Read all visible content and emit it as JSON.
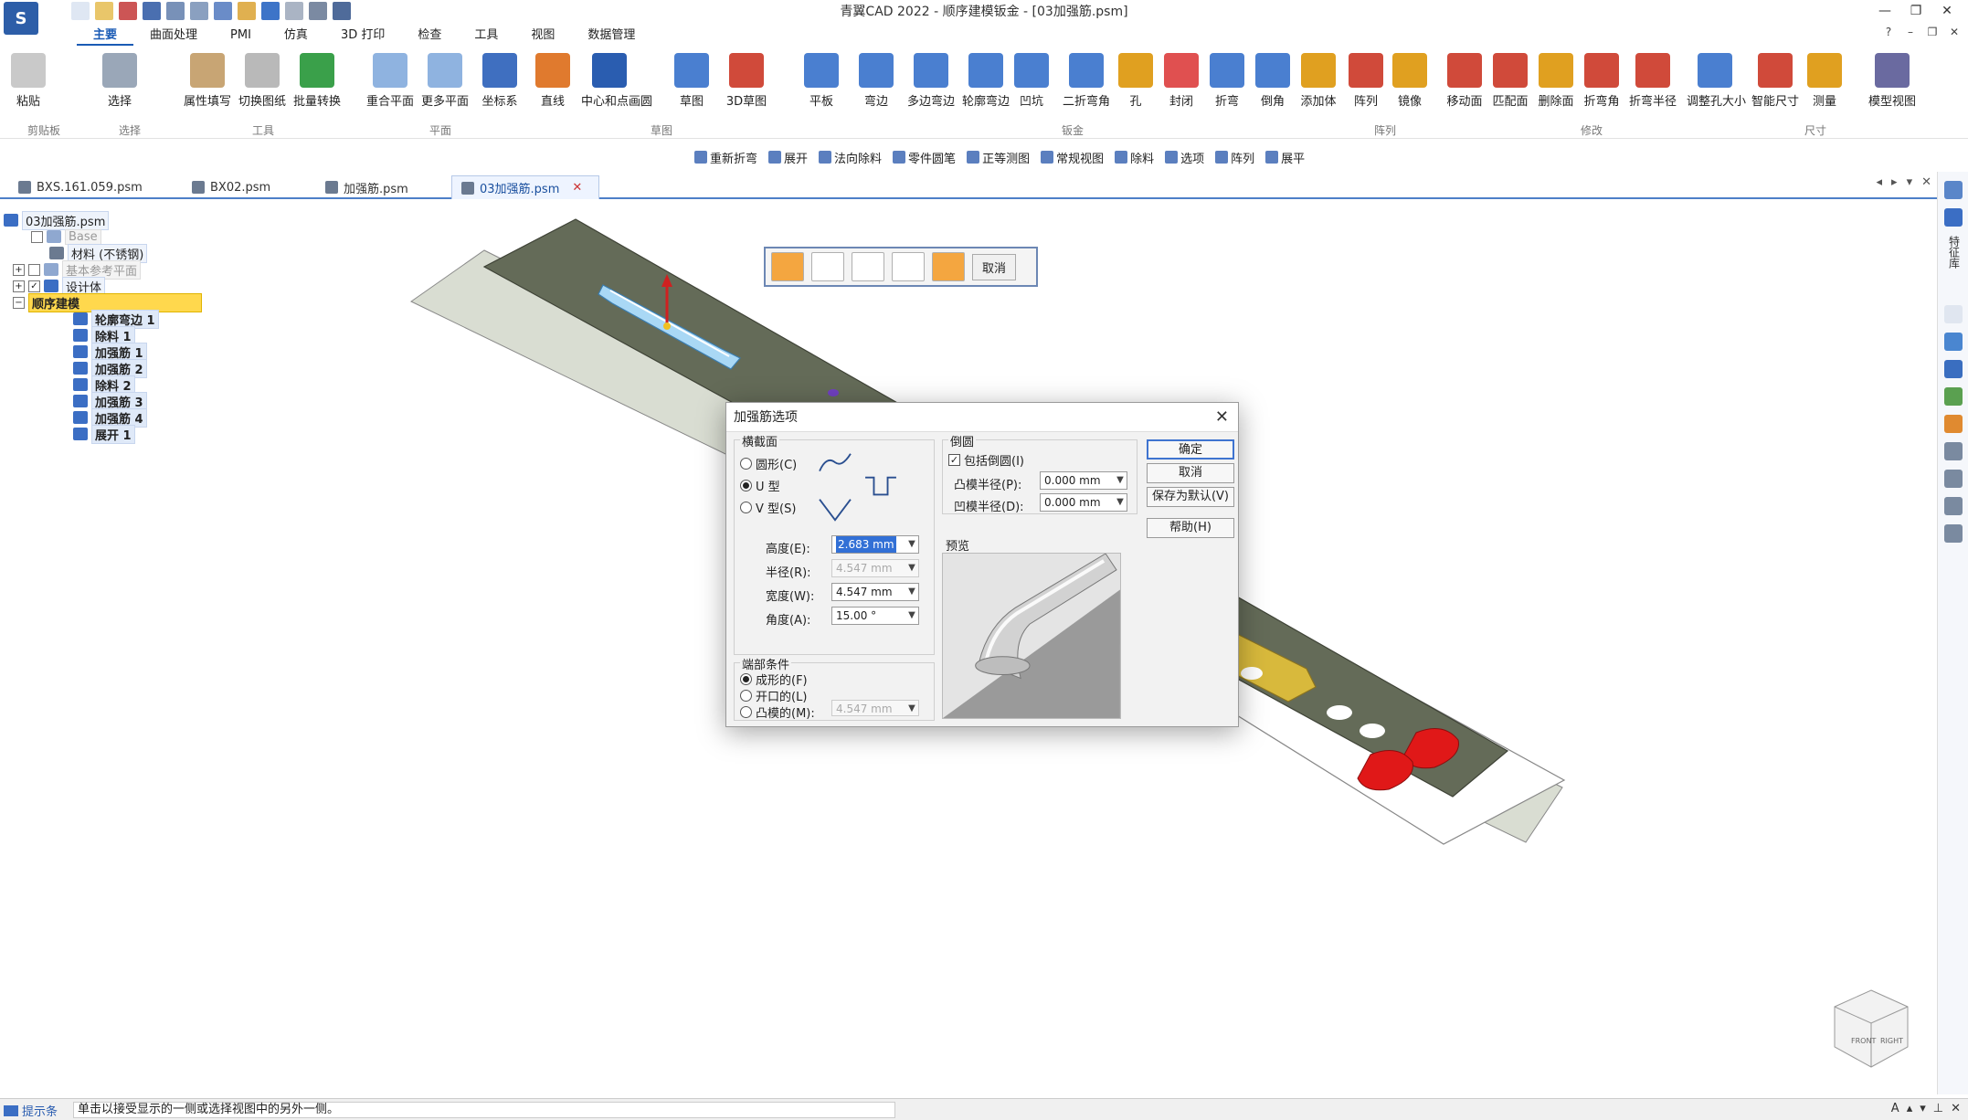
{
  "app": {
    "logo": "S",
    "title": "青翼CAD 2022 - 顺序建模钣金 - [03加强筋.psm]"
  },
  "window_controls": [
    "—",
    "❐",
    "✕"
  ],
  "ribbon_tabs": [
    "主要",
    "曲面处理",
    "PMI",
    "仿真",
    "3D 打印",
    "检查",
    "工具",
    "视图",
    "数据管理"
  ],
  "ribbon_buttons": [
    {
      "label": "粘贴",
      "color": "#c9c9c9"
    },
    {
      "label": "选择",
      "color": "#9aa7b8"
    },
    {
      "label": "属性填写",
      "color": "#c8a574"
    },
    {
      "label": "切换图纸",
      "color": "#b9b9b9"
    },
    {
      "label": "批量转换",
      "color": "#3aa04a"
    },
    {
      "label": "重合平面",
      "color": "#8fb3e0"
    },
    {
      "label": "更多平面",
      "color": "#8fb3e0"
    },
    {
      "label": "坐标系",
      "color": "#3f6fc0"
    },
    {
      "label": "直线",
      "color": "#e07a2e"
    },
    {
      "label": "中心和点画圆",
      "color": "#2a5db0"
    },
    {
      "label": "草图",
      "color": "#4a7fd0"
    },
    {
      "label": "3D草图",
      "color": "#d04a3a"
    },
    {
      "label": "平板",
      "color": "#4a7fd0"
    },
    {
      "label": "弯边",
      "color": "#4a7fd0"
    },
    {
      "label": "多边弯边",
      "color": "#4a7fd0"
    },
    {
      "label": "轮廓弯边",
      "color": "#4a7fd0"
    },
    {
      "label": "凹坑",
      "color": "#4a7fd0"
    },
    {
      "label": "二折弯角",
      "color": "#4a7fd0"
    },
    {
      "label": "孔",
      "color": "#e0a020"
    },
    {
      "label": "封闭",
      "color": "#e05050"
    },
    {
      "label": "折弯",
      "color": "#4a7fd0"
    },
    {
      "label": "倒角",
      "color": "#4a7fd0"
    },
    {
      "label": "添加体",
      "color": "#e0a020"
    },
    {
      "label": "阵列",
      "color": "#d04a3a"
    },
    {
      "label": "镜像",
      "color": "#e0a020"
    },
    {
      "label": "移动面",
      "color": "#d04a3a"
    },
    {
      "label": "匹配面",
      "color": "#d04a3a"
    },
    {
      "label": "删除面",
      "color": "#e0a020"
    },
    {
      "label": "折弯角",
      "color": "#d04a3a"
    },
    {
      "label": "折弯半径",
      "color": "#d04a3a"
    },
    {
      "label": "调整孔大小",
      "color": "#4a7fd0"
    },
    {
      "label": "智能尺寸",
      "color": "#d04a3a"
    },
    {
      "label": "测量",
      "color": "#e0a020"
    },
    {
      "label": "模型视图",
      "color": "#6a6aa0"
    }
  ],
  "ribbon_groups": [
    "剪贴板",
    "选择",
    "工具",
    "平面",
    "草图",
    "钣金",
    "阵列",
    "修改",
    "尺寸"
  ],
  "command_bar": [
    "重新折弯",
    "展开",
    "法向除料",
    "零件圆笔",
    "正等测图",
    "常规视图",
    "除料",
    "选项",
    "阵列",
    "展平"
  ],
  "doc_tabs": [
    {
      "label": "BXS.161.059.psm"
    },
    {
      "label": "BX02.psm"
    },
    {
      "label": "加强筋.psm"
    },
    {
      "label": "03加强筋.psm"
    }
  ],
  "tree": [
    {
      "label": "03加强筋.psm"
    },
    {
      "label": "Base"
    },
    {
      "label": "材料 (不锈钢)"
    },
    {
      "label": "基本参考平面"
    },
    {
      "label": "设计体"
    },
    {
      "label": "顺序建模"
    },
    {
      "label": "轮廓弯边 1"
    },
    {
      "label": "除料 1"
    },
    {
      "label": "加强筋 1"
    },
    {
      "label": "加强筋 2"
    },
    {
      "label": "除料 2"
    },
    {
      "label": "加强筋 3"
    },
    {
      "label": "加强筋 4"
    },
    {
      "label": "展开 1"
    }
  ],
  "float_toolbar": {
    "cancel": "取消"
  },
  "dialog": {
    "title": "加强筋选项",
    "cross_section": {
      "legend": "横截面",
      "options": [
        "圆形(C)",
        "U 型",
        "V 型(S)"
      ],
      "selected": 1
    },
    "fields": {
      "height": {
        "label": "高度(E):",
        "value": "2.683 mm"
      },
      "radius": {
        "label": "半径(R):",
        "value": "4.547 mm"
      },
      "width": {
        "label": "宽度(W):",
        "value": "4.547 mm"
      },
      "angle": {
        "label": "角度(A):",
        "value": "15.00 °"
      }
    },
    "end_condition": {
      "legend": "端部条件",
      "options": [
        "成形的(F)",
        "开口的(L)",
        "凸模的(M):"
      ],
      "selected": 0,
      "punch_value": "4.547 mm"
    },
    "rounding": {
      "legend": "倒圆",
      "include": "包括倒圆(I)",
      "punch_radius_label": "凸模半径(P):",
      "punch_radius": "0.000 mm",
      "die_radius_label": "凹模半径(D):",
      "die_radius": "0.000 mm"
    },
    "preview_label": "预览",
    "buttons": {
      "ok": "确定",
      "cancel": "取消",
      "save_default": "保存为默认(V)",
      "help": "帮助(H)"
    }
  },
  "sidebar_label": "特征库",
  "status": {
    "tag": "提示条",
    "message": "单击以接受显示的一侧或选择视图中的另外一侧。"
  },
  "viewcube": {
    "front": "FRONT",
    "right": "RIGHT"
  },
  "colors": {
    "accent": "#1a5bb5",
    "plate_top": "#646b58",
    "plate_edge": "#cfd4c8",
    "rib_blue": "#a9d8f5",
    "rib_gold": "#d8b93c",
    "rib_red": "#e01818",
    "tree_highlight": "#ffd84d"
  }
}
